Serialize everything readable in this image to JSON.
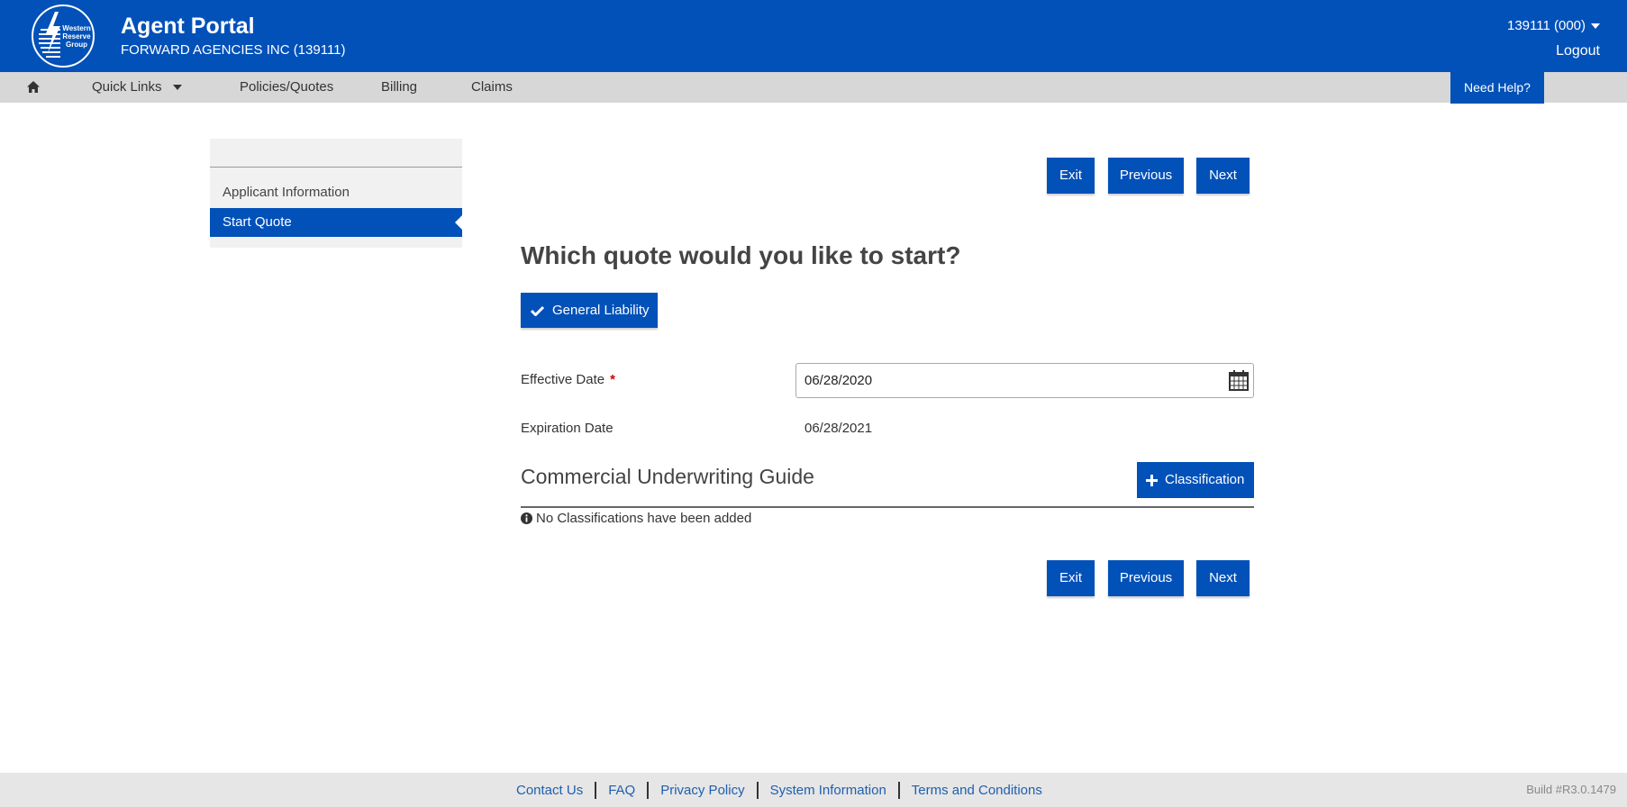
{
  "header": {
    "logo_text": "Western Reserve Group",
    "app_title": "Agent Portal",
    "agency": "FORWARD AGENCIES INC (139111)",
    "account": "139111 (000)",
    "logout": "Logout"
  },
  "nav": {
    "quick_links": "Quick Links",
    "policies": "Policies/Quotes",
    "billing": "Billing",
    "claims": "Claims",
    "help": "Need Help?"
  },
  "sidebar": {
    "items": [
      {
        "label": "Applicant Information",
        "active": false
      },
      {
        "label": "Start Quote",
        "active": true
      }
    ]
  },
  "actions": {
    "exit": "Exit",
    "previous": "Previous",
    "next": "Next"
  },
  "form": {
    "question": "Which quote would you like to start?",
    "selected_line": "General Liability",
    "effective_label": "Effective Date",
    "required_mark": "*",
    "effective_value": "06/28/2020",
    "expiration_label": "Expiration Date",
    "expiration_value": "06/28/2021"
  },
  "guide": {
    "title": "Commercial Underwriting Guide",
    "add_button": "Classification",
    "empty_message": "No Classifications have been added"
  },
  "footer": {
    "links": [
      "Contact Us",
      "FAQ",
      "Privacy Policy",
      "System Information",
      "Terms and Conditions"
    ],
    "build": "Build #R3.0.1479"
  },
  "colors": {
    "brand": "#0251b9",
    "nav_bg": "#d7d7d7",
    "footer_bg": "#e6e6e6"
  }
}
